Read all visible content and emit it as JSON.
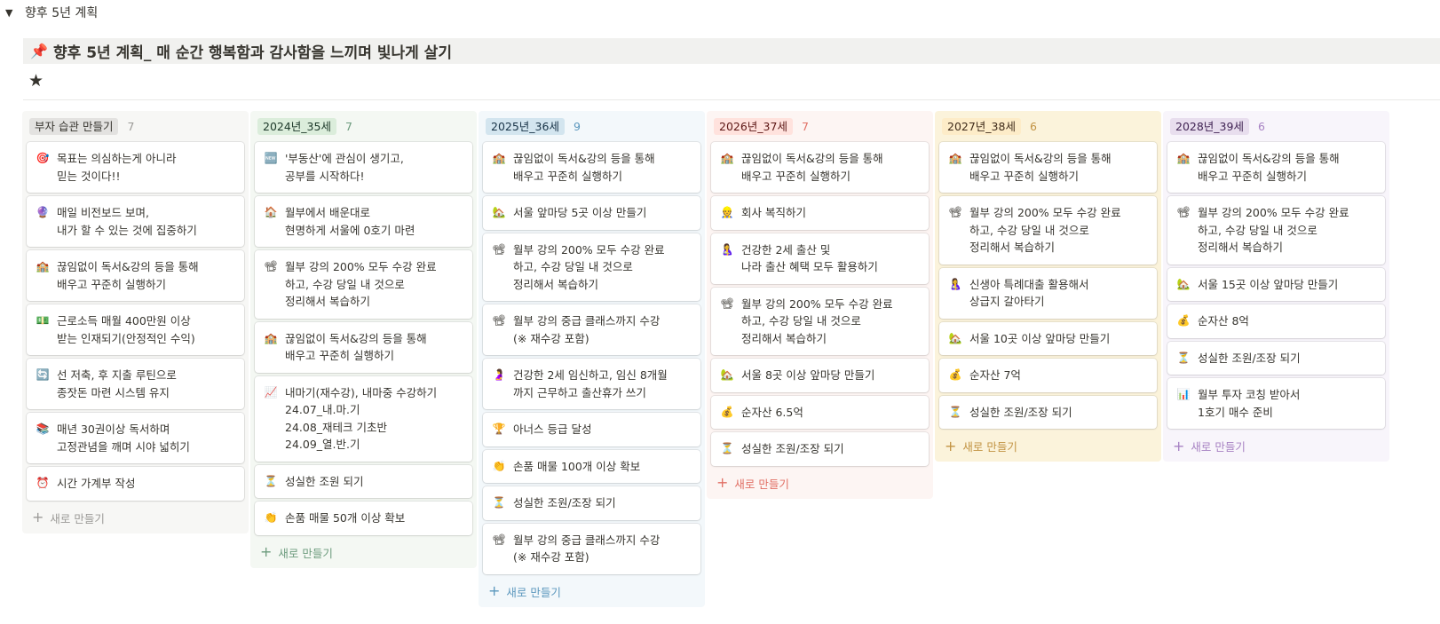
{
  "toggle": {
    "arrow": "▼",
    "label": "향후 5년 계획"
  },
  "callout": {
    "icon": "📌",
    "text": "향후 5년 계획_ 매 순간 행복함과 감사함을 느끼며 빛나게 살기"
  },
  "star": "★",
  "new_label": "새로 만들기",
  "columns": [
    {
      "tag": "부자 습관 만들기",
      "count": "7",
      "colors": {
        "bg": "#f7f7f5",
        "tag_bg": "#e3e2e0",
        "tag_text": "#37352f",
        "count_text": "#9b9a97",
        "new_text": "#9b9a97"
      },
      "cards": [
        {
          "icon": "🎯",
          "icon_name": "target-icon",
          "text": "목표는 의심하는게 아니라\n믿는 것이다!!"
        },
        {
          "icon": "🔮",
          "icon_name": "crystal-ball-icon",
          "text": "매일 비전보드 보며,\n내가 할 수 있는 것에 집중하기"
        },
        {
          "icon": "🏫",
          "icon_name": "school-icon",
          "text": "끊임없이 독서&강의 등을 통해\n배우고 꾸준히 실행하기"
        },
        {
          "icon": "💵",
          "icon_name": "money-icon",
          "text": "근로소득 매월 400만원 이상\n받는 인재되기(안정적인 수익)"
        },
        {
          "icon": "🔄",
          "icon_name": "cycle-icon",
          "text": "선 저축, 후 지출 루틴으로\n종잣돈 마련 시스템 유지"
        },
        {
          "icon": "📚",
          "icon_name": "books-icon",
          "text": "매년 30권이상 독서하며\n고정관념을 깨며 시야 넓히기"
        },
        {
          "icon": "⏰",
          "icon_name": "alarm-clock-icon",
          "text": "시간 가계부 작성"
        }
      ]
    },
    {
      "tag": "2024년_35세",
      "count": "7",
      "colors": {
        "bg": "#f4f8f3",
        "tag_bg": "#dbeddb",
        "tag_text": "#1c3829",
        "count_text": "#6c9b7d",
        "new_text": "#6c9b7d"
      },
      "cards": [
        {
          "icon": "🆕",
          "icon_name": "new-icon",
          "text": "'부동산'에 관심이 생기고,\n공부를 시작하다!"
        },
        {
          "icon": "🏠",
          "icon_name": "house-icon",
          "text": "월부에서 배운대로\n현명하게 서울에 0호기 마련"
        },
        {
          "icon": "📽",
          "icon_name": "projector-icon",
          "text": "월부 강의 200% 모두 수강 완료\n하고, 수강 당일 내 것으로\n정리해서 복습하기"
        },
        {
          "icon": "🏫",
          "icon_name": "school-icon",
          "text": "끊임없이 독서&강의 등을 통해\n배우고 꾸준히 실행하기"
        },
        {
          "icon": "📈",
          "icon_name": "chart-up-icon",
          "text": "내마기(재수강), 내마중 수강하기\n24.07_내.마.기\n24.08_재테크 기초반\n24.09_열.반.기"
        },
        {
          "icon": "⏳",
          "icon_name": "hourglass-icon",
          "text": "성실한 조원 되기"
        },
        {
          "icon": "👏",
          "icon_name": "clap-icon",
          "text": "손품 매물 50개 이상 확보"
        }
      ]
    },
    {
      "tag": "2025년_36세",
      "count": "9",
      "colors": {
        "bg": "#f3f8fb",
        "tag_bg": "#d3e5ef",
        "tag_text": "#183347",
        "count_text": "#5b97bd",
        "new_text": "#5b97bd"
      },
      "cards": [
        {
          "icon": "🏫",
          "icon_name": "school-icon",
          "text": "끊임없이 독서&강의 등을 통해\n배우고 꾸준히 실행하기"
        },
        {
          "icon": "🏡",
          "icon_name": "house-garden-icon",
          "text": "서울 앞마당 5곳 이상 만들기"
        },
        {
          "icon": "📽",
          "icon_name": "projector-icon",
          "text": "월부 강의 200% 모두 수강 완료\n하고, 수강 당일 내 것으로\n정리해서 복습하기"
        },
        {
          "icon": "📽",
          "icon_name": "projector-icon",
          "text": "월부 강의 중급 클래스까지 수강\n(※ 재수강 포함)"
        },
        {
          "icon": "🤰",
          "icon_name": "pregnant-icon",
          "text": "건강한 2세 임신하고, 임신 8개월\n까지 근무하고 출산휴가 쓰기"
        },
        {
          "icon": "🏆",
          "icon_name": "trophy-icon",
          "text": "아너스 등급 달성"
        },
        {
          "icon": "👏",
          "icon_name": "clap-icon",
          "text": "손품 매물 100개 이상 확보"
        },
        {
          "icon": "⏳",
          "icon_name": "hourglass-icon",
          "text": "성실한 조원/조장 되기"
        },
        {
          "icon": "📽",
          "icon_name": "projector-icon",
          "text": "월부 강의 중급 클래스까지 수강\n(※ 재수강 포함)"
        }
      ]
    },
    {
      "tag": "2026년_37세",
      "count": "7",
      "colors": {
        "bg": "#fdf5f3",
        "tag_bg": "#ffe2dd",
        "tag_text": "#5d1715",
        "count_text": "#e16f64",
        "new_text": "#e16f64"
      },
      "cards": [
        {
          "icon": "🏫",
          "icon_name": "school-icon",
          "text": "끊임없이 독서&강의 등을 통해\n배우고 꾸준히 실행하기"
        },
        {
          "icon": "👷",
          "icon_name": "worker-icon",
          "text": "회사 복직하기"
        },
        {
          "icon": "🤱",
          "icon_name": "baby-icon",
          "text": "건강한 2세 출산 및\n나라 출산 혜택 모두 활용하기"
        },
        {
          "icon": "📽",
          "icon_name": "projector-icon",
          "text": "월부 강의 200% 모두 수강 완료\n하고, 수강 당일 내 것으로\n정리해서 복습하기"
        },
        {
          "icon": "🏡",
          "icon_name": "house-garden-icon",
          "text": "서울 8곳 이상 앞마당 만들기"
        },
        {
          "icon": "💰",
          "icon_name": "money-bag-icon",
          "text": "순자산 6.5억"
        },
        {
          "icon": "⏳",
          "icon_name": "hourglass-icon",
          "text": "성실한 조원/조장 되기"
        }
      ]
    },
    {
      "tag": "2027년_38세",
      "count": "6",
      "colors": {
        "bg": "#fbf3db",
        "tag_bg": "#fdecc8",
        "tag_text": "#402c1b",
        "count_text": "#c29343",
        "new_text": "#c29343"
      },
      "cards": [
        {
          "icon": "🏫",
          "icon_name": "school-icon",
          "text": "끊임없이 독서&강의 등을 통해\n배우고 꾸준히 실행하기"
        },
        {
          "icon": "📽",
          "icon_name": "projector-icon",
          "text": "월부 강의 200% 모두 수강 완료\n하고, 수강 당일 내 것으로\n정리해서 복습하기"
        },
        {
          "icon": "🤱",
          "icon_name": "baby-icon",
          "text": "신생아 특례대출 활용해서\n상급지 갈아타기"
        },
        {
          "icon": "🏡",
          "icon_name": "house-garden-icon",
          "text": "서울 10곳 이상 앞마당 만들기"
        },
        {
          "icon": "💰",
          "icon_name": "money-bag-icon",
          "text": "순자산 7억"
        },
        {
          "icon": "⏳",
          "icon_name": "hourglass-icon",
          "text": "성실한 조원/조장 되기"
        }
      ]
    },
    {
      "tag": "2028년_39세",
      "count": "6",
      "colors": {
        "bg": "#f8f5fb",
        "tag_bg": "#e8deee",
        "tag_text": "#412454",
        "count_text": "#a782c3",
        "new_text": "#a782c3"
      },
      "cards": [
        {
          "icon": "🏫",
          "icon_name": "school-icon",
          "text": "끊임없이 독서&강의 등을 통해\n배우고 꾸준히 실행하기"
        },
        {
          "icon": "📽",
          "icon_name": "projector-icon",
          "text": "월부 강의 200% 모두 수강 완료\n하고, 수강 당일 내 것으로\n정리해서 복습하기"
        },
        {
          "icon": "🏡",
          "icon_name": "house-garden-icon",
          "text": "서울 15곳 이상 앞마당 만들기"
        },
        {
          "icon": "💰",
          "icon_name": "money-bag-icon",
          "text": "순자산 8억"
        },
        {
          "icon": "⏳",
          "icon_name": "hourglass-icon",
          "text": "성실한 조원/조장 되기"
        },
        {
          "icon": "📊",
          "icon_name": "bar-chart-icon",
          "text": "월부 투자 코칭 받아서\n1호기 매수 준비"
        }
      ]
    }
  ]
}
